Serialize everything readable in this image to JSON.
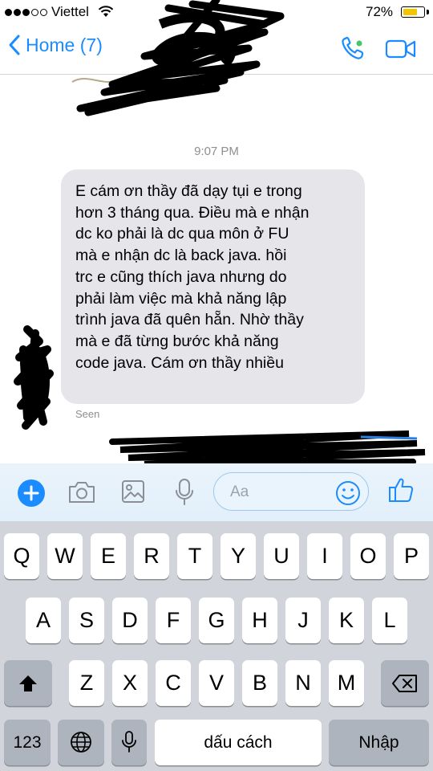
{
  "status_bar": {
    "carrier": "Viettel",
    "battery_percent": "72%",
    "battery_level": 0.72,
    "signal_bars_filled": 3,
    "signal_bars_total": 5
  },
  "nav": {
    "back_label": "Home (7)"
  },
  "conversation": {
    "timestamp": "9:07 PM",
    "message_text": "E cám ơn thầy đã dạy tụi e trong\nhơn 3 tháng qua. Điều mà e nhận\ndc ko phải là dc qua môn ở FU\nmà e nhận dc là back java. hồi\ntrc e cũng thích java nhưng do\nphải làm việc mà khả năng lập\ntrình java đã quên hẵn. Nhờ thầy\nmà e đã từng bước khả năng\ncode java. Cám ơn thầy nhiều",
    "seen_label": "Seen"
  },
  "composer": {
    "placeholder": "Aa"
  },
  "keyboard": {
    "row1": [
      "Q",
      "W",
      "E",
      "R",
      "T",
      "Y",
      "U",
      "I",
      "O",
      "P"
    ],
    "row2": [
      "A",
      "S",
      "D",
      "F",
      "G",
      "H",
      "J",
      "K",
      "L"
    ],
    "row3": [
      "Z",
      "X",
      "C",
      "V",
      "B",
      "N",
      "M"
    ],
    "numbers_key": "123",
    "space_key": "dấu cách",
    "return_key": "Nhập"
  },
  "colors": {
    "accent": "#1a8cff",
    "bubble": "#e5e5ea",
    "keyboard_bg": "#d1d5db",
    "battery": "#f5c400"
  }
}
